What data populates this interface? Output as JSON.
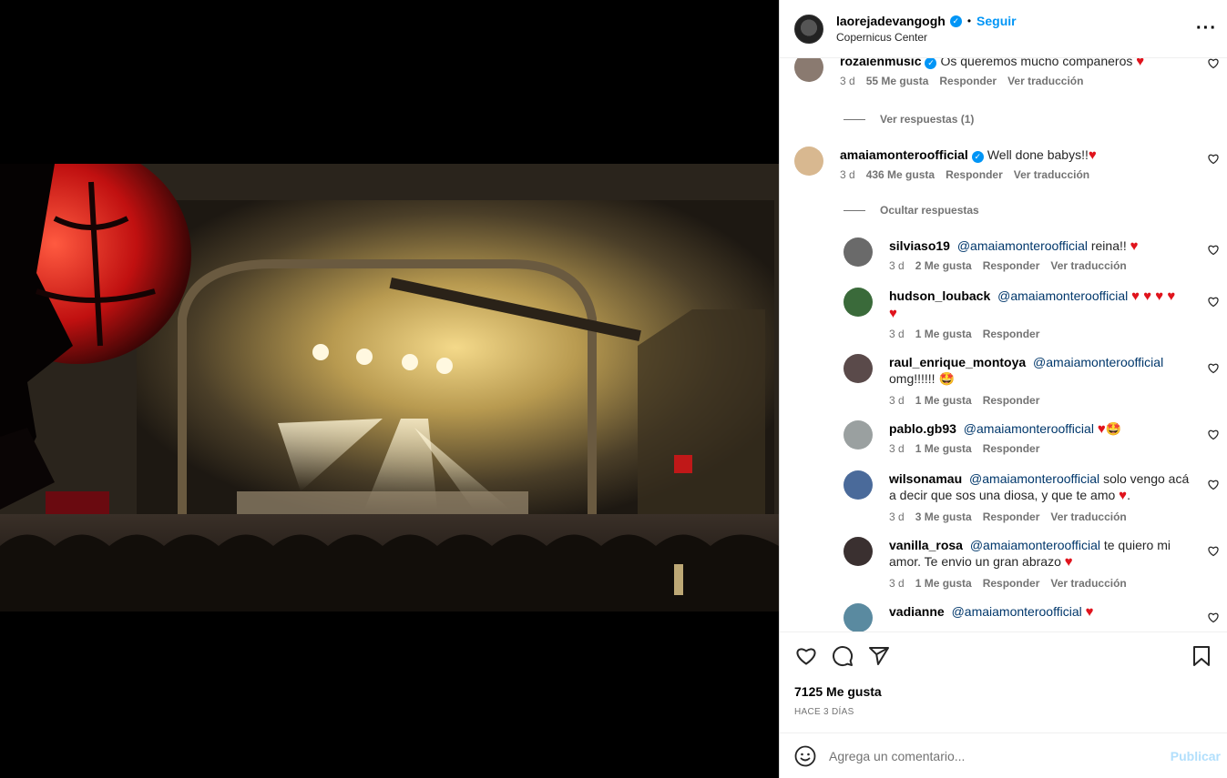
{
  "post": {
    "username": "laorejadevangogh",
    "follow_label": "Seguir",
    "separator": "•",
    "location": "Copernicus Center",
    "more_label": "···"
  },
  "comments": [
    {
      "username": "rozalenmusic",
      "verified": true,
      "text": "Os queremos mucho compañeros",
      "emoji": "♥",
      "time": "3 d",
      "likes": "55 Me gusta",
      "reply": "Responder",
      "translate": "Ver traducción",
      "avatar_color": "#8a7a70"
    },
    {
      "username": "amaiamonteroofficial",
      "verified": true,
      "text": "Well done babys!!",
      "emoji": "♥",
      "time": "3 d",
      "likes": "436 Me gusta",
      "reply": "Responder",
      "translate": "Ver traducción",
      "avatar_color": "#d8b890"
    }
  ],
  "view_replies_label": "Ver respuestas (1)",
  "hide_replies_label": "Ocultar respuestas",
  "replies": [
    {
      "username": "silviaso19",
      "mention": "@amaiamonteroofficial",
      "text": "reina!!",
      "emoji": "♥",
      "time": "3 d",
      "likes": "2 Me gusta",
      "reply": "Responder",
      "translate": "Ver traducción",
      "avatar_color": "#6a6a6a"
    },
    {
      "username": "hudson_louback",
      "mention": "@amaiamonteroofficial",
      "text": "",
      "emoji": "♥ ♥ ♥ ♥",
      "emoji2": "♥",
      "time": "3 d",
      "likes": "1 Me gusta",
      "reply": "Responder",
      "avatar_color": "#3a6a3a"
    },
    {
      "username": "raul_enrique_montoya",
      "mention": "@amaiamonteroofficial",
      "text": "omg!!!!!!",
      "emoji": "🤩",
      "time": "3 d",
      "likes": "1 Me gusta",
      "reply": "Responder",
      "avatar_color": "#5a4a4a"
    },
    {
      "username": "pablo.gb93",
      "mention": "@amaiamonteroofficial",
      "text": "",
      "emoji": "♥",
      "emoji2": "🤩",
      "time": "3 d",
      "likes": "1 Me gusta",
      "reply": "Responder",
      "avatar_color": "#9aa0a0"
    },
    {
      "username": "wilsonamau",
      "mention": "@amaiamonteroofficial",
      "text": "solo vengo acá a decir que sos una diosa, y que te amo",
      "emoji": "♥",
      "text_after": ".",
      "time": "3 d",
      "likes": "3 Me gusta",
      "reply": "Responder",
      "translate": "Ver traducción",
      "avatar_color": "#4a6a9a"
    },
    {
      "username": "vanilla_rosa",
      "mention": "@amaiamonteroofficial",
      "text": "te quiero mi amor. Te envio un gran abrazo",
      "emoji": "♥",
      "time": "3 d",
      "likes": "1 Me gusta",
      "reply": "Responder",
      "translate": "Ver traducción",
      "avatar_color": "#3a3030"
    },
    {
      "username": "vadianne",
      "mention": "@amaiamonteroofficial",
      "text": "",
      "emoji": "♥",
      "avatar_color": "#5a8aa0"
    }
  ],
  "footer": {
    "likes": "7125 Me gusta",
    "ago": "HACE 3 DÍAS",
    "comment_placeholder": "Agrega un comentario...",
    "publish_label": "Publicar"
  },
  "colors": {
    "accent": "#0095f6",
    "heart": "#e0131c",
    "mention": "#00376b"
  }
}
